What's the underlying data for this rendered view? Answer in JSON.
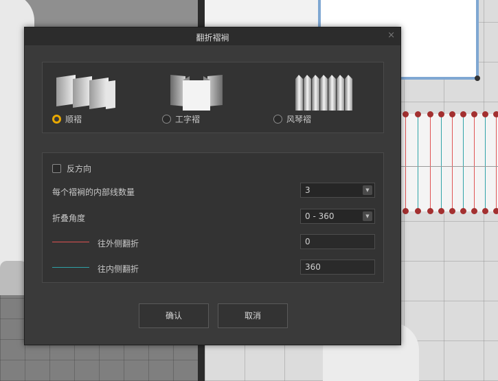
{
  "dialog": {
    "title": "翻折褶裥",
    "close_icon": "×"
  },
  "pleat_types": [
    {
      "label": "顺褶",
      "checked": true,
      "icon": "knife-pleat-icon"
    },
    {
      "label": "工字褶",
      "checked": false,
      "icon": "box-pleat-icon"
    },
    {
      "label": "风琴褶",
      "checked": false,
      "icon": "accordion-pleat-icon"
    }
  ],
  "options": {
    "reverse_label": "反方向",
    "reverse_checked": false,
    "inner_lines_label": "每个褶裥的内部线数量",
    "inner_lines_value": "3",
    "fold_angle_label": "折叠角度",
    "fold_angle_value": "0 - 360",
    "outer_fold_label": "往外侧翻折",
    "outer_fold_value": "0",
    "outer_fold_color": "#e05252",
    "inner_fold_label": "往内侧翻折",
    "inner_fold_value": "360",
    "inner_fold_color": "#2fa3a8"
  },
  "buttons": {
    "ok": "确认",
    "cancel": "取消"
  },
  "colors": {
    "accent": "#e8a800",
    "dialog_bg": "#3a3a3a",
    "titlebar_bg": "#2c2c2c"
  }
}
